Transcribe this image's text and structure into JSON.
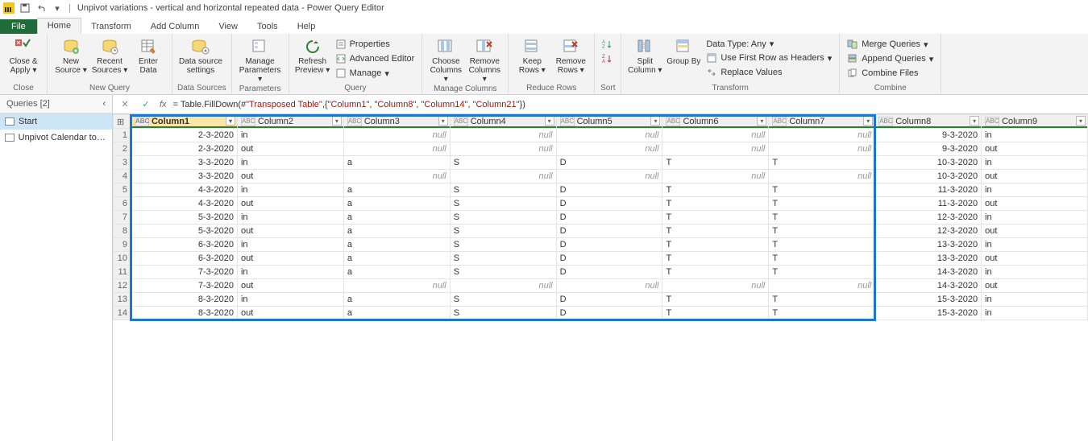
{
  "window_title": "Unpivot variations - vertical and horizontal repeated data - Power Query Editor",
  "tabs": [
    "File",
    "Home",
    "Transform",
    "Add Column",
    "View",
    "Tools",
    "Help"
  ],
  "active_tab": "Home",
  "ribbon": {
    "close_apply": "Close & Apply",
    "close_group": "Close",
    "new_source": "New Source",
    "recent_sources": "Recent Sources",
    "enter_data": "Enter Data",
    "new_query_group": "New Query",
    "data_source_settings": "Data source settings",
    "data_sources_group": "Data Sources",
    "manage_parameters": "Manage Parameters",
    "parameters_group": "Parameters",
    "refresh_preview": "Refresh Preview",
    "properties": "Properties",
    "advanced_editor": "Advanced Editor",
    "manage": "Manage",
    "query_group": "Query",
    "choose_columns": "Choose Columns",
    "remove_columns": "Remove Columns",
    "manage_columns_group": "Manage Columns",
    "keep_rows": "Keep Rows",
    "remove_rows": "Remove Rows",
    "reduce_rows_group": "Reduce Rows",
    "sort_group": "Sort",
    "split_column": "Split Column",
    "group_by": "Group By",
    "data_type": "Data Type: Any",
    "first_row_headers": "Use First Row as Headers",
    "replace_values": "Replace Values",
    "transform_group": "Transform",
    "merge_queries": "Merge Queries",
    "append_queries": "Append Queries",
    "combine_files": "Combine Files",
    "combine_group": "Combine"
  },
  "queries_header": "Queries [2]",
  "queries": [
    "Start",
    "Unpivot Calendar to T..."
  ],
  "formula": {
    "prefix": "= Table.FillDown(#",
    "arg0": "\"Transposed Table\"",
    "mid": ",{",
    "cols": [
      "\"Column1\"",
      "\"Column8\"",
      "\"Column14\"",
      "\"Column21\""
    ],
    "suffix": "})"
  },
  "columns": [
    "Column1",
    "Column2",
    "Column3",
    "Column4",
    "Column5",
    "Column6",
    "Column7",
    "Column8",
    "Column9"
  ],
  "type_label": "ABC 123",
  "rows": [
    [
      "2-3-2020",
      "in",
      null,
      null,
      null,
      null,
      null,
      "9-3-2020",
      "in"
    ],
    [
      "2-3-2020",
      "out",
      null,
      null,
      null,
      null,
      null,
      "9-3-2020",
      "out"
    ],
    [
      "3-3-2020",
      "in",
      "a",
      "S",
      "D",
      "T",
      "T",
      "10-3-2020",
      "in"
    ],
    [
      "3-3-2020",
      "out",
      null,
      null,
      null,
      null,
      null,
      "10-3-2020",
      "out"
    ],
    [
      "4-3-2020",
      "in",
      "a",
      "S",
      "D",
      "T",
      "T",
      "11-3-2020",
      "in"
    ],
    [
      "4-3-2020",
      "out",
      "a",
      "S",
      "D",
      "T",
      "T",
      "11-3-2020",
      "out"
    ],
    [
      "5-3-2020",
      "in",
      "a",
      "S",
      "D",
      "T",
      "T",
      "12-3-2020",
      "in"
    ],
    [
      "5-3-2020",
      "out",
      "a",
      "S",
      "D",
      "T",
      "T",
      "12-3-2020",
      "out"
    ],
    [
      "6-3-2020",
      "in",
      "a",
      "S",
      "D",
      "T",
      "T",
      "13-3-2020",
      "in"
    ],
    [
      "6-3-2020",
      "out",
      "a",
      "S",
      "D",
      "T",
      "T",
      "13-3-2020",
      "out"
    ],
    [
      "7-3-2020",
      "in",
      "a",
      "S",
      "D",
      "T",
      "T",
      "14-3-2020",
      "in"
    ],
    [
      "7-3-2020",
      "out",
      null,
      null,
      null,
      null,
      null,
      "14-3-2020",
      "out"
    ],
    [
      "8-3-2020",
      "in",
      "a",
      "S",
      "D",
      "T",
      "T",
      "15-3-2020",
      "in"
    ],
    [
      "8-3-2020",
      "out",
      "a",
      "S",
      "D",
      "T",
      "T",
      "15-3-2020",
      "in"
    ]
  ]
}
